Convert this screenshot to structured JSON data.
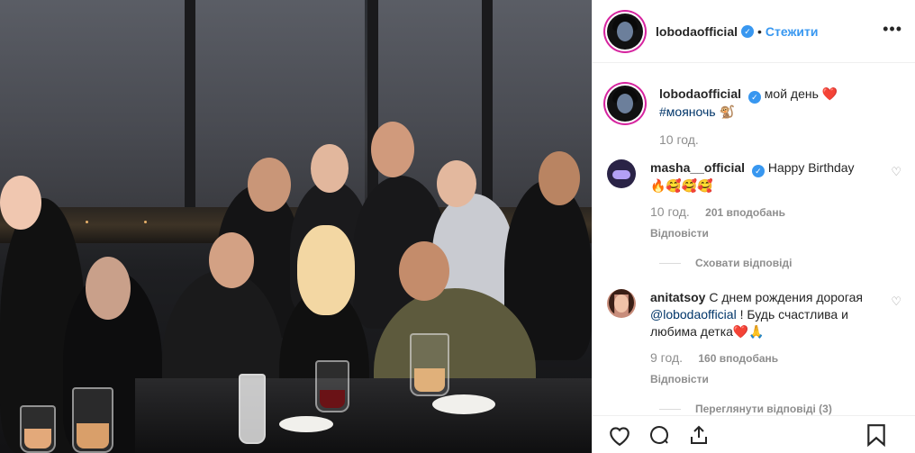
{
  "header": {
    "username": "lobodaofficial",
    "separator": "•",
    "follow_label": "Стежити",
    "more_label": "•••"
  },
  "caption": {
    "username": "lobodaofficial",
    "text": "мой день ❤️",
    "hashtag": "#мояночь",
    "emoji": "🐒",
    "time": "10 год."
  },
  "comments": [
    {
      "username": "masha__official",
      "text": "Happy Birthday",
      "emojis": "🔥🥰🥰🥰",
      "time": "10 год.",
      "likes": "201 вподобань",
      "reply": "Відповісти",
      "replies_toggle": "Сховати відповіді"
    },
    {
      "username": "anitatsoy",
      "text_before": "С днем рождения дорогая ",
      "mention": "@lobodaofficial",
      "text_after": " ! Будь счастлива и любима детка❤️🙏",
      "time": "9 год.",
      "likes": "160 вподобань",
      "reply": "Відповісти",
      "replies_toggle": "Переглянути відповіді (3)"
    }
  ],
  "icons": [
    "verified-badge-icon",
    "more-icon",
    "heart-icon",
    "comment-icon",
    "share-icon",
    "bookmark-icon"
  ],
  "colors": {
    "link": "#3897f0",
    "verified": "#3897f0",
    "heart": "#ed4956",
    "muted": "#8e8e8e"
  }
}
